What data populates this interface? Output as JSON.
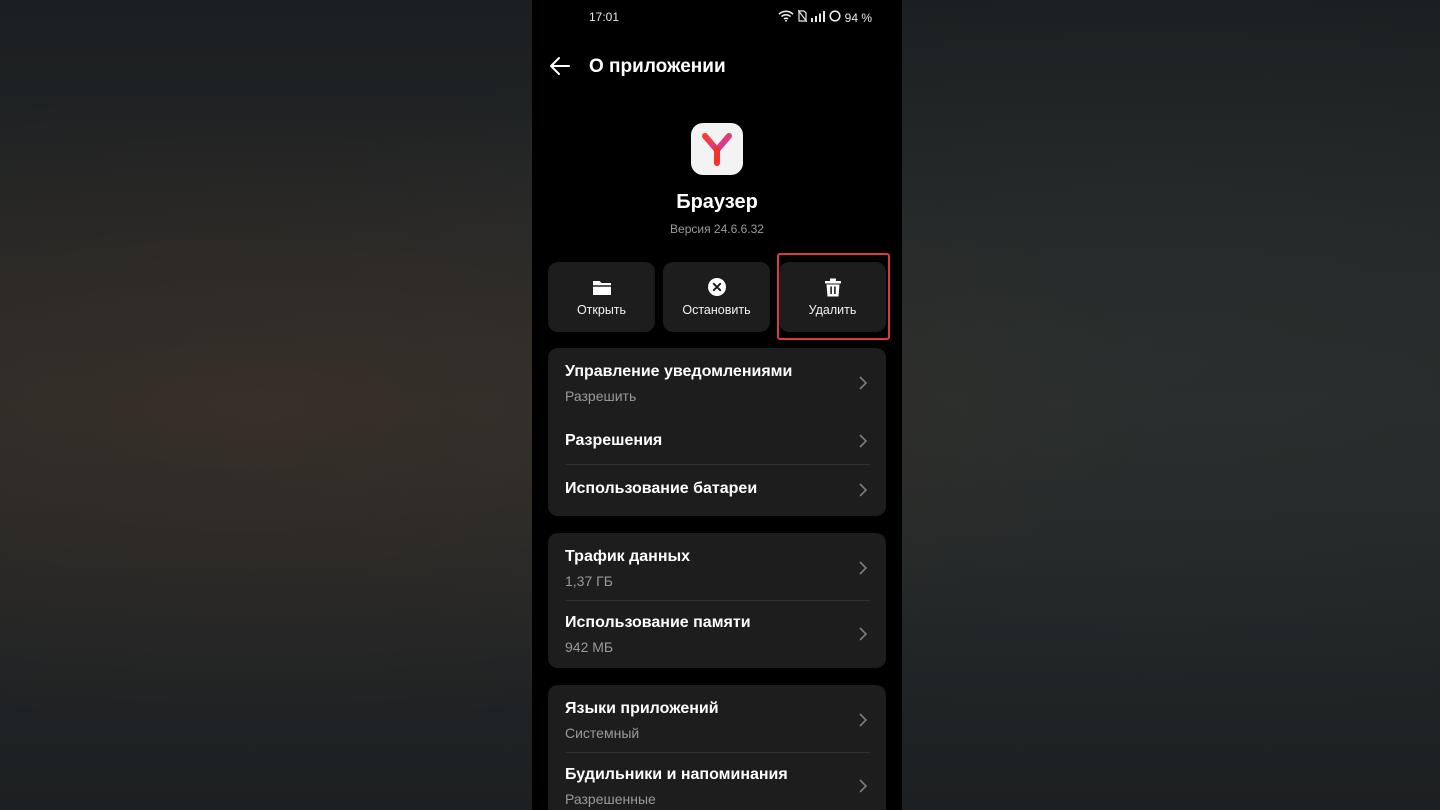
{
  "status_bar": {
    "time": "17:01",
    "battery": "94 %",
    "icons": [
      "wifi-icon",
      "no-sim-icon",
      "signal-icon",
      "battery-ring-icon"
    ]
  },
  "header": {
    "title": "О приложении",
    "back_icon": "back-arrow-icon"
  },
  "app": {
    "name": "Браузер",
    "version": "Версия 24.6.6.32",
    "icon": "yandex-browser-logo"
  },
  "actions": {
    "open": {
      "label": "Открыть",
      "icon": "folder-icon"
    },
    "stop": {
      "label": "Остановить",
      "icon": "stop-circle-icon"
    },
    "delete": {
      "label": "Удалить",
      "icon": "trash-icon",
      "highlighted": true
    }
  },
  "settings": {
    "notifications": {
      "title": "Управление уведомлениями",
      "value": "Разрешить"
    },
    "permissions": {
      "title": "Разрешения"
    },
    "battery": {
      "title": "Использование батареи"
    },
    "traffic": {
      "title": "Трафик данных",
      "value": "1,37 ГБ"
    },
    "memory": {
      "title": "Использование памяти",
      "value": "942 МБ"
    },
    "languages": {
      "title": "Языки приложений",
      "value": "Системный"
    },
    "alarms": {
      "title": "Будильники и напоминания",
      "value": "Разрешенные"
    }
  },
  "colors": {
    "highlight": "#e0383e",
    "card_bg": "#1d1d1d",
    "screen_bg": "#000000",
    "secondary_text": "#9a9a9a"
  }
}
